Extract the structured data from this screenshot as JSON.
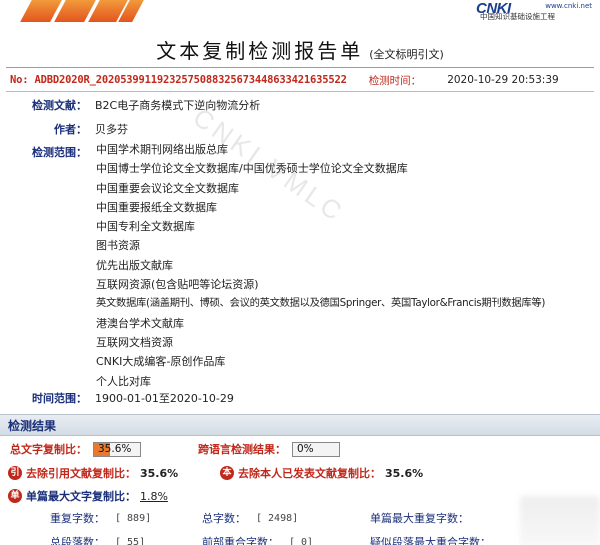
{
  "header": {
    "brand_mark": "CNKI",
    "brand_sub": "中国知识基础设施工程",
    "brand_url": "www.cnki.net",
    "title": "文本复制检测报告单",
    "subtitle": "(全文标明引文)"
  },
  "report": {
    "id": "No: ADBD2020R_20205399119232575088325673448633421635522",
    "time_label": "检测时间：",
    "time": "2020-10-29 20:53:39"
  },
  "fields": {
    "doc_label": "检测文献：",
    "doc_value": "B2C电子商务模式下逆向物流分析",
    "author_label": "作者：",
    "author_value": "贝多芬",
    "scope_label": "检测范围：",
    "time_range_label": "时间范围：",
    "time_range_value": "1900-01-01至2020-10-29"
  },
  "databases": [
    "中国学术期刊网络出版总库",
    "中国博士学位论文全文数据库/中国优秀硕士学位论文全文数据库",
    "中国重要会议论文全文数据库",
    "中国重要报纸全文数据库",
    "中国专利全文数据库",
    "图书资源",
    "优先出版文献库",
    "互联网资源(包含贴吧等论坛资源)",
    "英文数据库(涵盖期刊、博硕、会议的英文数据以及德国Springer、英国Taylor&Francis期刊数据库等)",
    "港澳台学术文献库",
    "互联网文档资源",
    "CNKI大成编客-原创作品库",
    "个人比对库"
  ],
  "watermark": "CNKI  VMLC",
  "results": {
    "section_title": "检测结果",
    "total_label": "总文字复制比：",
    "total_value": "35.6%",
    "total_fraction": 0.356,
    "cross_label": "跨语言检测结果：",
    "cross_value": "0%",
    "cross_fraction": 0.0,
    "excl_ref_badge": "引",
    "excl_ref_label": "去除引用文献复制比：",
    "excl_ref_value": "35.6%",
    "excl_self_badge": "本",
    "excl_self_label": "去除本人已发表文献复制比：",
    "excl_self_value": "35.6%",
    "single_badge": "单",
    "single_label": "单篇最大文字复制比：",
    "single_value": "1.8%",
    "dup_chars_label": "重复字数：",
    "dup_chars_value": "[ 889]",
    "total_chars_label": "总字数：",
    "total_chars_value": "[ 2498]",
    "single_dup_label": "单篇最大重复字数：",
    "paragraphs_label": "总段落数：",
    "paragraphs_value": "[ 55]",
    "front_overlap_label": "前部重合字数：",
    "front_overlap_value": "[ 0]",
    "suspect_label": "疑似段落最大重合字数："
  }
}
